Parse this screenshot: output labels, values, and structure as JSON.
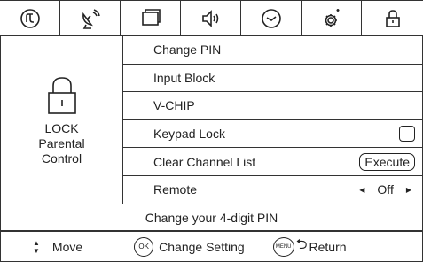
{
  "tabs": [
    {
      "icon": "picture-icon"
    },
    {
      "icon": "satellite-dish-icon"
    },
    {
      "icon": "screen-icon"
    },
    {
      "icon": "speaker-icon"
    },
    {
      "icon": "clock-icon"
    },
    {
      "icon": "settings-gear-icon"
    },
    {
      "icon": "lock-icon"
    }
  ],
  "left_panel": {
    "icon": "padlock-icon",
    "line1": "LOCK",
    "line2": "Parental",
    "line3": "Control"
  },
  "menu": {
    "change_pin": "Change PIN",
    "input_block": "Input Block",
    "vchip": "V-CHIP",
    "keypad_lock": "Keypad Lock",
    "clear_channel_list": "Clear Channel List",
    "execute_label": "Execute",
    "remote": "Remote",
    "remote_value": "Off"
  },
  "help_text": "Change your 4-digit PIN",
  "legend": {
    "move": "Move",
    "ok_icon": "OK",
    "change_setting": "Change Setting",
    "menu_icon": "MENU",
    "return_label": "Return"
  }
}
